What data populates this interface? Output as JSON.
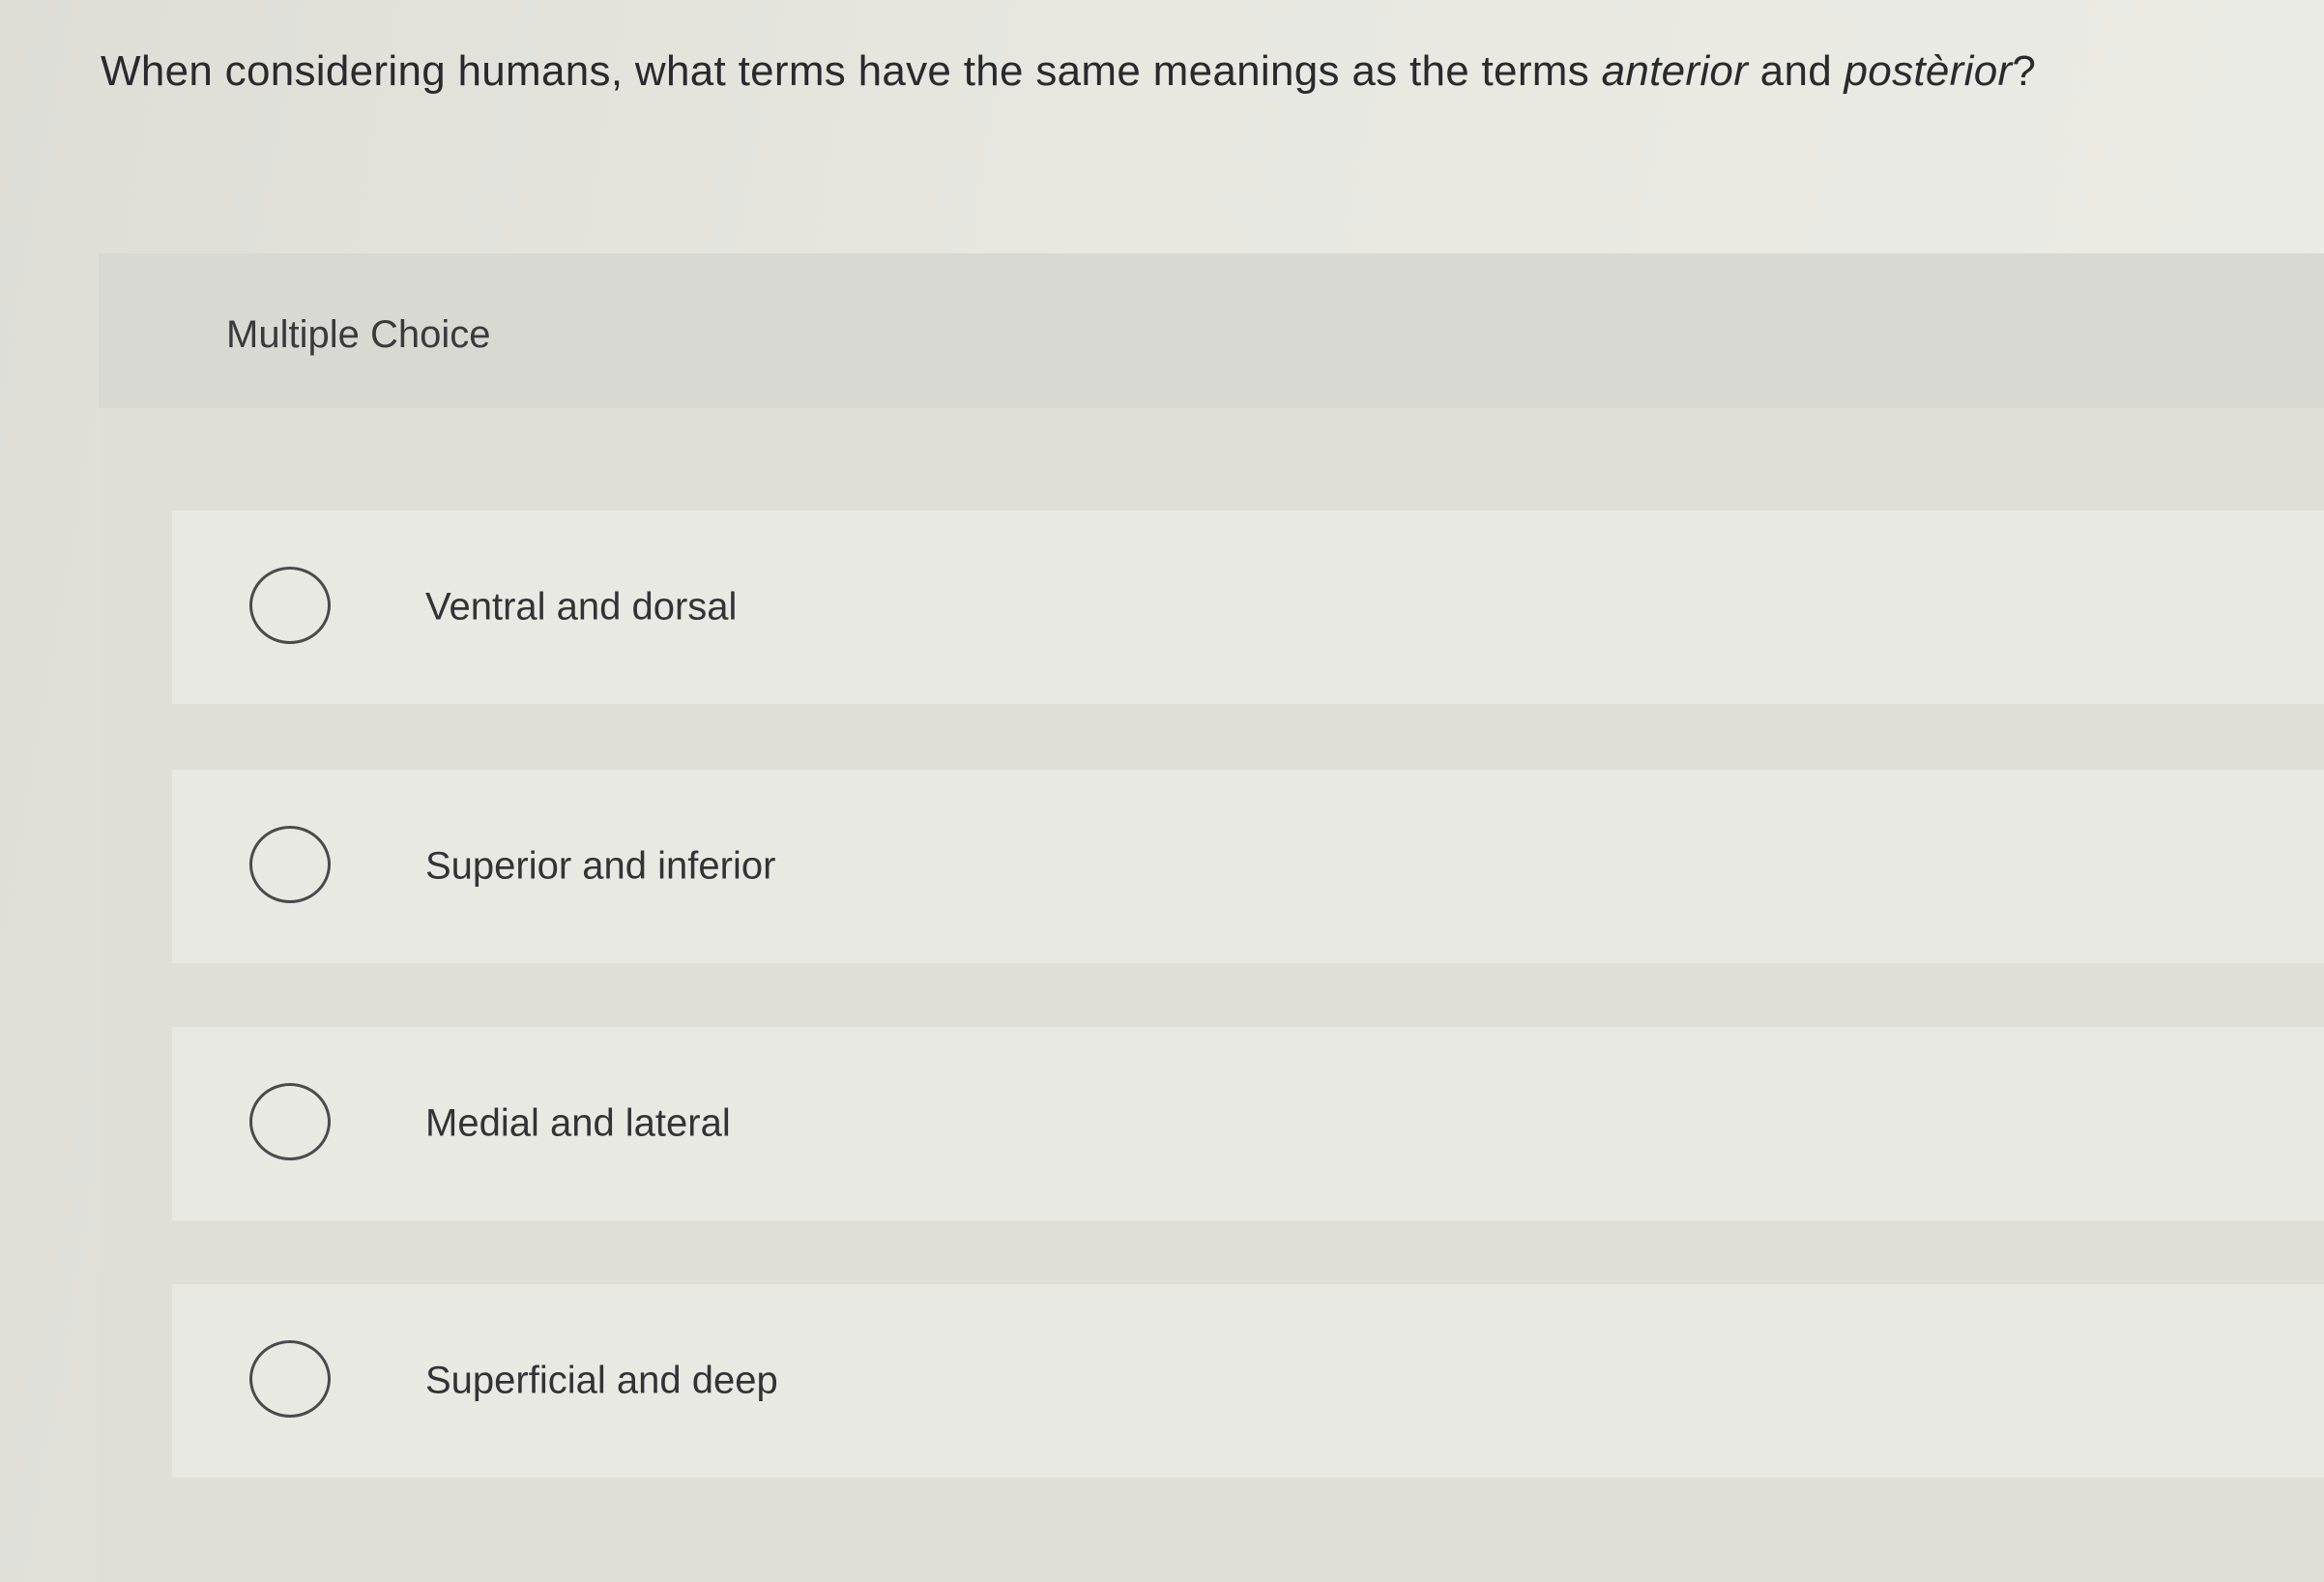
{
  "question": {
    "prefix": "When considering humans, what terms have the same meanings as the terms ",
    "term1": "anterior",
    "middle": " and ",
    "term2": "postèrior",
    "suffix": "?"
  },
  "panel": {
    "label": "Multiple Choice"
  },
  "options": [
    {
      "label": "Ventral and dorsal"
    },
    {
      "label": "Superior and inferior"
    },
    {
      "label": "Medial and lateral"
    },
    {
      "label": "Superficial and deep"
    }
  ]
}
